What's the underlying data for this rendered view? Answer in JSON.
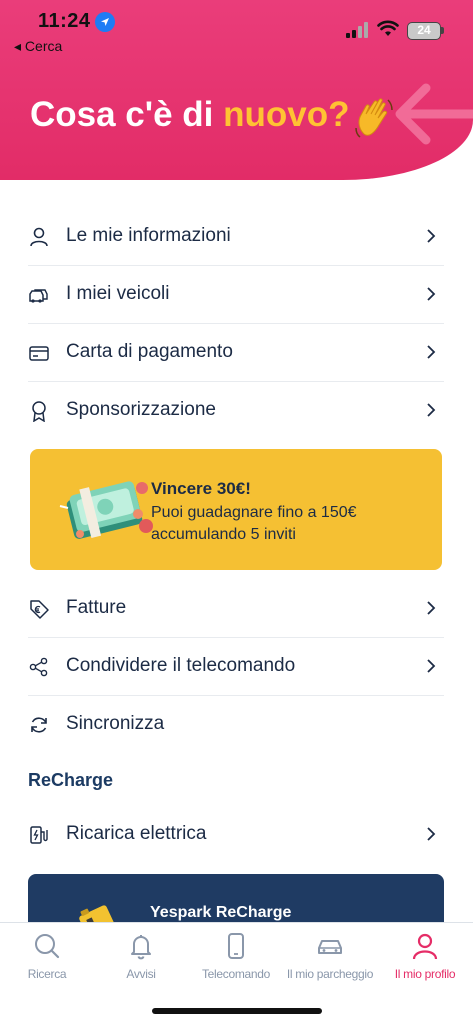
{
  "status_bar": {
    "time": "11:24",
    "back_label": "◂ Cerca",
    "battery": "24"
  },
  "header": {
    "title_prefix": "Cosa c'è di ",
    "title_accent": "nuovo?",
    "title_emoji": "👋"
  },
  "menu_items": [
    {
      "label": "Le mie informazioni",
      "icon": "user-icon"
    },
    {
      "label": "I miei veicoli",
      "icon": "cars-icon"
    },
    {
      "label": "Carta di pagamento",
      "icon": "credit-card-icon"
    },
    {
      "label": "Sponsorizzazione",
      "icon": "award-icon"
    }
  ],
  "promo": {
    "title": "Vincere 30€!",
    "text": "Puoi guadagnare fino a 150€ accumulando 5  inviti"
  },
  "menu_items_2": [
    {
      "label": "Fatture",
      "icon": "euro-tag-icon"
    },
    {
      "label": "Condividere il telecomando",
      "icon": "share-icon"
    },
    {
      "label": "Sincronizza",
      "icon": "sync-icon"
    }
  ],
  "section_recharge": {
    "title": "ReCharge"
  },
  "menu_items_3": [
    {
      "label": "Ricarica elettrica",
      "icon": "ev-charger-icon"
    }
  ],
  "recharge_card": {
    "title": "Yespark ReCharge"
  },
  "tabs": [
    {
      "label": "Ricerca",
      "icon": "search-icon",
      "active": false
    },
    {
      "label": "Avvisi",
      "icon": "bell-icon",
      "active": false
    },
    {
      "label": "Telecomando",
      "icon": "phone-icon",
      "active": false
    },
    {
      "label": "Il mio parcheggio",
      "icon": "car-icon",
      "active": false
    },
    {
      "label": "Il mio profilo",
      "icon": "profile-icon",
      "active": true
    }
  ],
  "colors": {
    "brand_pink": "#e52d67",
    "accent_yellow": "#ffc233",
    "promo_yellow": "#f5c033",
    "navy": "#1c2b45",
    "card_navy": "#1f3b63",
    "tab_inactive": "#8a97aa"
  }
}
